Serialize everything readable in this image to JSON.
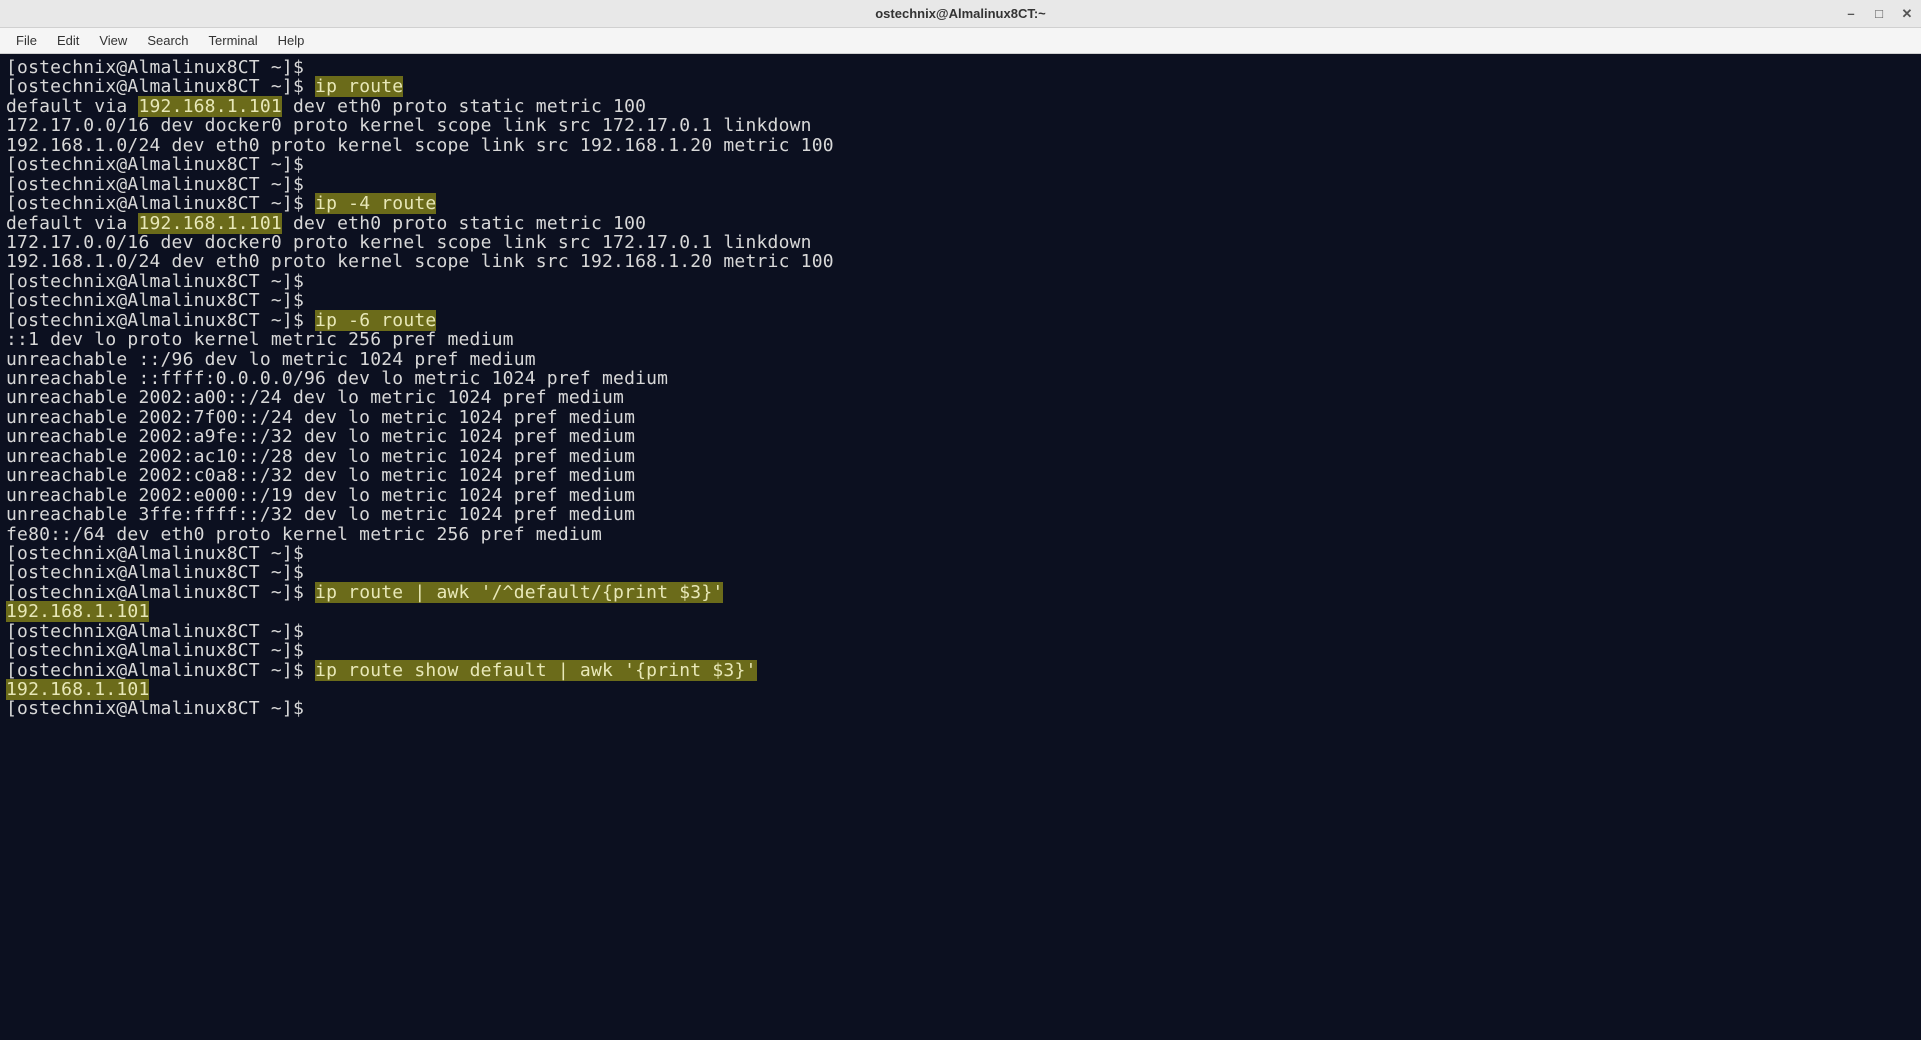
{
  "window": {
    "title": "ostechnix@Almalinux8CT:~"
  },
  "menu": {
    "file": "File",
    "edit": "Edit",
    "view": "View",
    "search": "Search",
    "terminal": "Terminal",
    "help": "Help"
  },
  "prompt": "[ostechnix@Almalinux8CT ~]$ ",
  "cmds": {
    "iproute": "ip route",
    "ip4route": "ip -4 route",
    "ip6route": "ip -6 route",
    "awk1": "ip route | awk '/^default/{print $3}'",
    "awk2": "ip route show default | awk '{print $3}'"
  },
  "out": {
    "def_pre": "default via ",
    "gw": "192.168.1.101",
    "def_post": " dev eth0 proto static metric 100",
    "docker": "172.17.0.0/16 dev docker0 proto kernel scope link src 172.17.0.1 linkdown",
    "lan": "192.168.1.0/24 dev eth0 proto kernel scope link src 192.168.1.20 metric 100",
    "v6_1": "::1 dev lo proto kernel metric 256 pref medium",
    "v6_2": "unreachable ::/96 dev lo metric 1024 pref medium",
    "v6_3": "unreachable ::ffff:0.0.0.0/96 dev lo metric 1024 pref medium",
    "v6_4": "unreachable 2002:a00::/24 dev lo metric 1024 pref medium",
    "v6_5": "unreachable 2002:7f00::/24 dev lo metric 1024 pref medium",
    "v6_6": "unreachable 2002:a9fe::/32 dev lo metric 1024 pref medium",
    "v6_7": "unreachable 2002:ac10::/28 dev lo metric 1024 pref medium",
    "v6_8": "unreachable 2002:c0a8::/32 dev lo metric 1024 pref medium",
    "v6_9": "unreachable 2002:e000::/19 dev lo metric 1024 pref medium",
    "v6_10": "unreachable 3ffe:ffff::/32 dev lo metric 1024 pref medium",
    "v6_11": "fe80::/64 dev eth0 proto kernel metric 256 pref medium",
    "gwonly": "192.168.1.101"
  }
}
